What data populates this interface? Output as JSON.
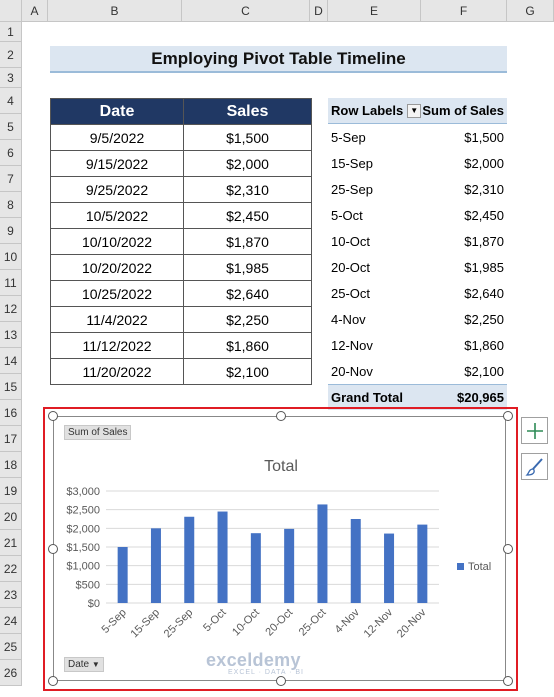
{
  "columns": [
    "A",
    "B",
    "C",
    "D",
    "E",
    "F",
    "G"
  ],
  "rows": [
    "1",
    "2",
    "3",
    "4",
    "5",
    "6",
    "7",
    "8",
    "9",
    "10",
    "11",
    "12",
    "13",
    "14",
    "15",
    "16",
    "17",
    "18",
    "19",
    "20",
    "21",
    "22",
    "23",
    "24",
    "25",
    "26"
  ],
  "title": "Employing Pivot Table Timeline",
  "source_table": {
    "headers": [
      "Date",
      "Sales"
    ],
    "rows": [
      [
        "9/5/2022",
        "$1,500"
      ],
      [
        "9/15/2022",
        "$2,000"
      ],
      [
        "9/25/2022",
        "$2,310"
      ],
      [
        "10/5/2022",
        "$2,450"
      ],
      [
        "10/10/2022",
        "$1,870"
      ],
      [
        "10/20/2022",
        "$1,985"
      ],
      [
        "10/25/2022",
        "$2,640"
      ],
      [
        "11/4/2022",
        "$2,250"
      ],
      [
        "11/12/2022",
        "$1,860"
      ],
      [
        "11/20/2022",
        "$2,100"
      ]
    ]
  },
  "pivot": {
    "row_labels": "Row Labels",
    "sum_header": "Sum of Sales",
    "rows": [
      [
        "5-Sep",
        "$1,500"
      ],
      [
        "15-Sep",
        "$2,000"
      ],
      [
        "25-Sep",
        "$2,310"
      ],
      [
        "5-Oct",
        "$2,450"
      ],
      [
        "10-Oct",
        "$1,870"
      ],
      [
        "20-Oct",
        "$1,985"
      ],
      [
        "25-Oct",
        "$2,640"
      ],
      [
        "4-Nov",
        "$2,250"
      ],
      [
        "12-Nov",
        "$1,860"
      ],
      [
        "20-Nov",
        "$2,100"
      ]
    ],
    "grand_total_label": "Grand Total",
    "grand_total_value": "$20,965"
  },
  "chart_field_buttons": {
    "values": "Sum of Sales",
    "axis": "Date"
  },
  "chart_data": {
    "type": "bar",
    "title": "Total",
    "categories": [
      "5-Sep",
      "15-Sep",
      "25-Sep",
      "5-Oct",
      "10-Oct",
      "20-Oct",
      "25-Oct",
      "4-Nov",
      "12-Nov",
      "20-Nov"
    ],
    "series": [
      {
        "name": "Total",
        "values": [
          1500,
          2000,
          2310,
          2450,
          1870,
          1985,
          2640,
          2250,
          1860,
          2100
        ]
      }
    ],
    "ylim": [
      0,
      3000
    ],
    "yticks": [
      "$0",
      "$500",
      "$1,000",
      "$1,500",
      "$2,000",
      "$2,500",
      "$3,000"
    ],
    "legend": "right",
    "grid": true,
    "bar_color": "#4472c4"
  },
  "watermark": {
    "name": "exceldemy",
    "tagline": "EXCEL · DATA · BI"
  },
  "colors": {
    "header_fill": "#203864",
    "title_fill": "#dce6f1",
    "selection": "#e01c24"
  }
}
